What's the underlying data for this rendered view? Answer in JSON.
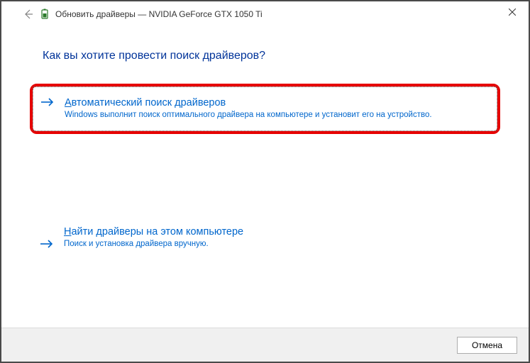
{
  "titlebar": {
    "title": "Обновить драйверы — NVIDIA GeForce GTX 1050 Ti"
  },
  "heading": "Как вы хотите провести поиск драйверов?",
  "option1": {
    "title_first": "А",
    "title_rest": "втоматический поиск драйверов",
    "desc": "Windows выполнит поиск оптимального драйвера на компьютере и установит его на устройство."
  },
  "option2": {
    "title_first": "Н",
    "title_rest": "айти драйверы на этом компьютере",
    "desc": "Поиск и установка драйвера вручную."
  },
  "footer": {
    "cancel": "Отмена"
  }
}
